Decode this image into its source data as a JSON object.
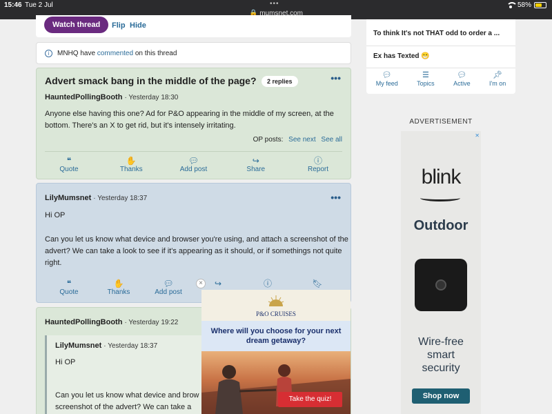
{
  "status_bar": {
    "time": "15:46",
    "date": "Tue 2 Jul",
    "url": "mumsnet.com",
    "battery": "58%"
  },
  "thread_bar": {
    "watch": "Watch thread",
    "flip": "Flip",
    "hide": "Hide"
  },
  "notice": {
    "prefix": "MNHQ have",
    "link": "commented",
    "suffix": "on this thread"
  },
  "posts": [
    {
      "title": "Advert smack bang in the middle of the page?",
      "replies": "2 replies",
      "author": "HauntedPollingBooth",
      "timestamp": "· Yesterday 18:30",
      "body": "Anyone else having this one? Ad for P&O appearing in the middle of my screen, at the bottom. There's an X to get rid, but it's intensely irritating.",
      "op_posts_label": "OP posts:",
      "see_next": "See next",
      "see_all": "See all"
    },
    {
      "author": "LilyMumsnet",
      "timestamp": "· Yesterday 18:37",
      "greeting": "Hi OP",
      "body": "Can you let us know what device and browser you're using, and attach a screenshot of the advert? We can take a look to see if it's appearing as it should, or if somethings not quite right."
    },
    {
      "author": "HauntedPollingBooth",
      "timestamp": "· Yesterday 19:22",
      "quote_author": "LilyMumsnet",
      "quote_timestamp": "· Yesterday 18:37",
      "quote_greeting": "Hi OP",
      "quote_line1": "Can you let us know what device and brow",
      "quote_line2": "screenshot of the advert? We can take a"
    }
  ],
  "actions": {
    "quote": "Quote",
    "thanks": "Thanks",
    "add_post": "Add post",
    "share": "Share",
    "report": "Report"
  },
  "right_nav": {
    "items": [
      "To think It's not THAT odd to order a ...",
      "Ex has Texted 😁"
    ],
    "tabs": [
      "My feed",
      "Topics",
      "Active",
      "I'm on"
    ]
  },
  "advertisement_label": "ADVERTISEMENT",
  "blink_ad": {
    "logo": "blink",
    "headline": "Outdoor",
    "sub1": "Wire-free",
    "sub2": "smart",
    "sub3": "security",
    "cta": "Shop now"
  },
  "po_ad": {
    "brand": "P&O CRUISES",
    "question": "Where will you choose for your next dream getaway?",
    "cta": "Take the quiz!"
  },
  "colors": {
    "accent_purple": "#6a2a7f",
    "link_blue": "#2a6b98",
    "post_green": "#dbe7d8",
    "post_blue": "#cfdbe6"
  }
}
